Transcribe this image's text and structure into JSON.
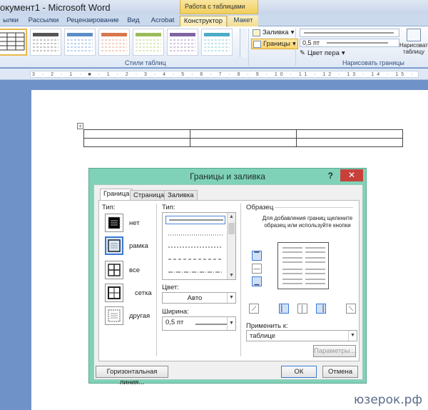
{
  "window": {
    "title": "окумент1 - Microsoft Word",
    "context_tab_header": "Работа с таблицами"
  },
  "ribbon_tabs": [
    "ылки",
    "Рассылки",
    "Рецензирование",
    "Вид",
    "Acrobat",
    "Конструктор",
    "Макет"
  ],
  "ribbon": {
    "styles_group_label": "Стили таблиц",
    "shading_label": "Заливка",
    "borders_label": "Границы",
    "line_weight": "0,5 пт",
    "pen_color_label": "Цвет пера",
    "draw_table_label": "Нарисовать таблицу",
    "draw_borders_group_label": "Нарисовать границы"
  },
  "ruler": {
    "numbers": "3 · 2 · 1 · ■ · 1 · 2 · 3 · 4 · 5 · 6 · 7 · 8 · 9 · 10 · 11 · 12 · 13 · 14 · 15 · 16 · 17"
  },
  "document": {
    "move_handle_glyph": "+",
    "rows": 2,
    "cols": 3
  },
  "dialog": {
    "title": "Границы и заливка",
    "help_glyph": "?",
    "close_glyph": "✕",
    "tabs": [
      "Граница",
      "Страница",
      "Заливка"
    ],
    "type_label": "Тип:",
    "settings": [
      "нет",
      "рамка",
      "все",
      "сетка",
      "другая"
    ],
    "line_type_label": "Тип:",
    "color_label": "Цвет:",
    "color_value": "Авто",
    "width_label": "Ширина:",
    "width_value": "0,5 пт",
    "preview_label": "Образец",
    "preview_hint": "Для добавления границ щелкните образец или используйте кнопки",
    "apply_to_label": "Применить к:",
    "apply_to_value": "таблице",
    "options_button": "Параметры...",
    "horizontal_line_button": "Горизонтальная линия...",
    "ok_button": "ОК",
    "cancel_button": "Отмена"
  },
  "watermark": "юзерок.рф",
  "colors": {
    "dialog_frame": "#7fd2b8",
    "close_button": "#c7413a",
    "selection": "#3c79d6",
    "workspace": "#6f92c9"
  }
}
